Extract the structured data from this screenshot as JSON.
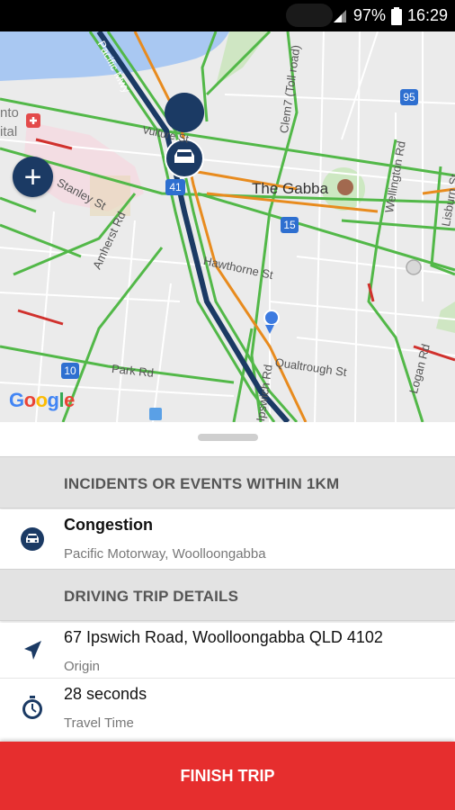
{
  "status_bar": {
    "battery": "97%",
    "time": "16:29"
  },
  "map": {
    "labels": {
      "gabba": "The Gabba",
      "stanley": "Stanley St",
      "amherst": "Amherst Rd",
      "hawthorne": "Hawthorne St",
      "park": "Park Rd",
      "qualtrough": "Qualtrough St",
      "wellington": "Wellington Rd",
      "lisburn": "Lisburn St",
      "logan": "Logan Rd",
      "ipswich": "Ipswich Rd",
      "cleveland": "Clem7 (Toll road)",
      "pacific": "Pacific Mwy",
      "vulture": "Vulture St",
      "ontotal_1": "nto",
      "ontotal_2": "ital"
    },
    "route_shields": [
      "95",
      "41",
      "15",
      "10"
    ],
    "add_button": "+",
    "google": [
      "G",
      "o",
      "o",
      "g",
      "l",
      "e"
    ]
  },
  "incidents": {
    "header": "INCIDENTS OR EVENTS WITHIN 1KM",
    "items": [
      {
        "title": "Congestion",
        "subtitle": "Pacific Motorway, Woolloongabba",
        "icon": "car-icon"
      }
    ]
  },
  "trip": {
    "header": "DRIVING TRIP DETAILS",
    "origin": {
      "value": "67 Ipswich Road, Woolloongabba QLD 4102",
      "label": "Origin",
      "icon": "navigation-arrow-icon"
    },
    "travel_time": {
      "value": "28 seconds",
      "label": "Travel Time",
      "icon": "stopwatch-icon"
    }
  },
  "finish_button": "FINISH TRIP",
  "colors": {
    "primary_navy": "#1b3a64",
    "finish_red": "#e62e2e",
    "traffic_green": "#52b848",
    "traffic_orange": "#e88b1e",
    "traffic_red": "#d0312d"
  }
}
